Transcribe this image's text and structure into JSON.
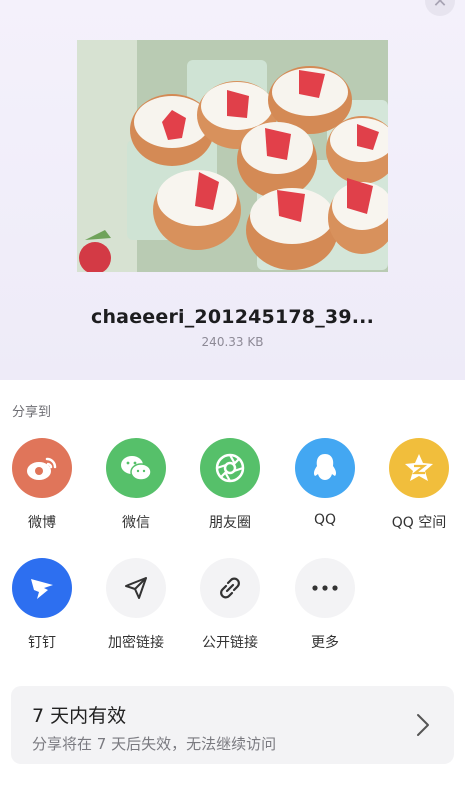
{
  "file": {
    "name": "chaeeeri_201245178_39...",
    "size": "240.33 KB"
  },
  "share": {
    "heading": "分享到",
    "row1": [
      {
        "label": "微博",
        "icon": "weibo-icon",
        "color": "#e0755a"
      },
      {
        "label": "微信",
        "icon": "wechat-icon",
        "color": "#56c06a"
      },
      {
        "label": "朋友圈",
        "icon": "moments-icon",
        "color": "#56c06a"
      },
      {
        "label": "QQ",
        "icon": "qq-icon",
        "color": "#43a7f2"
      },
      {
        "label": "QQ 空间",
        "icon": "qzone-icon",
        "color": "#f1be3c"
      }
    ],
    "row2": [
      {
        "label": "钉钉",
        "icon": "dingtalk-icon",
        "color": "#2d6ff0"
      },
      {
        "label": "加密链接",
        "icon": "send-icon",
        "color": "#f3f3f5"
      },
      {
        "label": "公开链接",
        "icon": "link-icon",
        "color": "#f3f3f5"
      },
      {
        "label": "更多",
        "icon": "more-icon",
        "color": "#f3f3f5"
      }
    ]
  },
  "validity": {
    "title": "7 天内有效",
    "subtitle": "分享将在 7 天后失效，无法继续访问"
  }
}
